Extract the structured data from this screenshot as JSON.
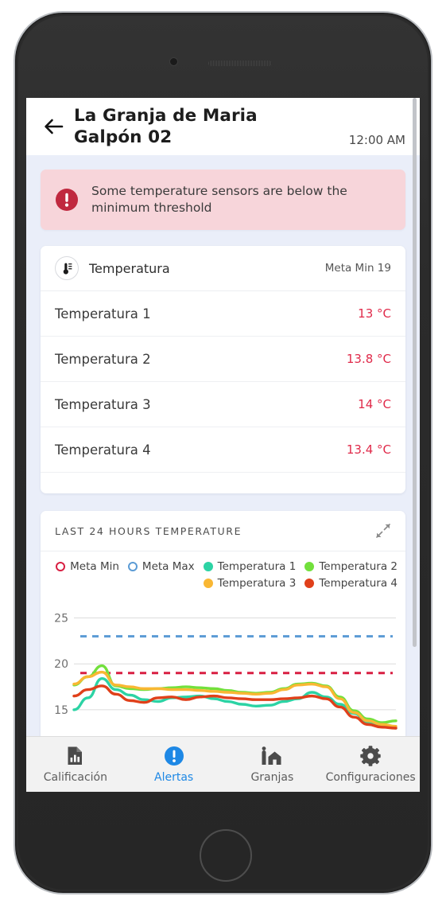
{
  "header": {
    "back_icon": "arrow-left-icon",
    "title_line1": "La Granja de Maria",
    "title_line2": "Galpón 02",
    "time": "12:00 AM"
  },
  "alert": {
    "icon": "alert-circle-icon",
    "message": "Some temperature sensors are below the minimum threshold",
    "bg_color": "#f7d5da",
    "icon_color": "#c0293f"
  },
  "temperature_card": {
    "icon": "thermometer-icon",
    "title": "Temperatura",
    "meta": "Meta Min 19",
    "value_color": "#e02a4a",
    "rows": [
      {
        "label": "Temperatura 1",
        "value": "13 °C"
      },
      {
        "label": "Temperatura 2",
        "value": "13.8 °C"
      },
      {
        "label": "Temperatura 3",
        "value": "14 °C"
      },
      {
        "label": "Temperatura 4",
        "value": "13.4 °C"
      }
    ]
  },
  "chart_card": {
    "title": "LAST 24 HOURS TEMPERATURE",
    "expand_icon": "expand-diagonal-icon",
    "legend": [
      {
        "label": "Meta Min",
        "color": "#d81f42",
        "style": "hollow"
      },
      {
        "label": "Meta Max",
        "color": "#5b9bd5",
        "style": "hollow"
      },
      {
        "label": "Temperatura 1",
        "color": "#2cd3a4",
        "style": "filled"
      },
      {
        "label": "Temperatura 2",
        "color": "#72e03c",
        "style": "filled"
      },
      {
        "label": "Temperatura 3",
        "color": "#f9b733",
        "style": "filled"
      },
      {
        "label": "Temperatura 4",
        "color": "#e0401a",
        "style": "filled"
      }
    ]
  },
  "chart_data": {
    "type": "line",
    "title": "LAST 24 HOURS TEMPERATURE",
    "xlabel": "",
    "ylabel": "",
    "ylim": [
      13,
      26
    ],
    "yticks": [
      15,
      20,
      25
    ],
    "grid": true,
    "legend_position": "top-right",
    "x": [
      0,
      1,
      2,
      3,
      4,
      5,
      6,
      7,
      8,
      9,
      10,
      11,
      12,
      13,
      14,
      15,
      16,
      17,
      18,
      19,
      20,
      21,
      22,
      23
    ],
    "series": [
      {
        "name": "Temperatura 1",
        "color": "#2cd3a4",
        "values": [
          15.0,
          16.3,
          18.4,
          17.2,
          16.6,
          16.1,
          15.9,
          16.3,
          16.4,
          16.5,
          16.2,
          15.9,
          15.6,
          15.4,
          15.5,
          15.9,
          16.2,
          16.9,
          16.4,
          15.6,
          14.6,
          13.6,
          13.2,
          13.0
        ]
      },
      {
        "name": "Temperatura 2",
        "color": "#72e03c",
        "values": [
          17.7,
          18.6,
          19.8,
          17.6,
          17.3,
          17.2,
          17.3,
          17.4,
          17.5,
          17.4,
          17.3,
          17.1,
          16.9,
          16.8,
          16.9,
          17.3,
          17.8,
          17.9,
          17.6,
          16.4,
          14.9,
          14.0,
          13.6,
          13.8
        ]
      },
      {
        "name": "Temperatura 3",
        "color": "#f9b733",
        "values": [
          17.8,
          18.6,
          19.1,
          17.7,
          17.5,
          17.3,
          17.3,
          17.2,
          17.2,
          17.1,
          17.0,
          16.9,
          16.8,
          16.7,
          16.8,
          17.2,
          17.7,
          17.8,
          17.5,
          16.2,
          14.7,
          13.8,
          13.4,
          13.2
        ]
      },
      {
        "name": "Temperatura 4",
        "color": "#e0401a",
        "values": [
          16.5,
          17.2,
          17.6,
          16.7,
          16.0,
          15.8,
          16.3,
          16.4,
          16.1,
          16.4,
          16.5,
          16.3,
          16.2,
          16.1,
          16.1,
          16.2,
          16.3,
          16.5,
          16.2,
          15.3,
          14.2,
          13.4,
          13.1,
          13.0
        ]
      }
    ],
    "threshold_lines": [
      {
        "name": "Meta Max",
        "value": 23,
        "color": "#5b9bd5",
        "style": "dashed"
      },
      {
        "name": "Meta Min",
        "value": 19,
        "color": "#d81f42",
        "style": "dashed"
      }
    ]
  },
  "tabbar": {
    "items": [
      {
        "label": "Calificación",
        "icon": "document-chart-icon",
        "active": false
      },
      {
        "label": "Alertas",
        "icon": "alert-circle-icon",
        "active": true
      },
      {
        "label": "Granjas",
        "icon": "barn-icon",
        "active": false
      },
      {
        "label": "Configuraciones",
        "icon": "gear-icon",
        "active": false
      }
    ],
    "active_color": "#1e88e5",
    "inactive_color": "#5d5d5d"
  }
}
